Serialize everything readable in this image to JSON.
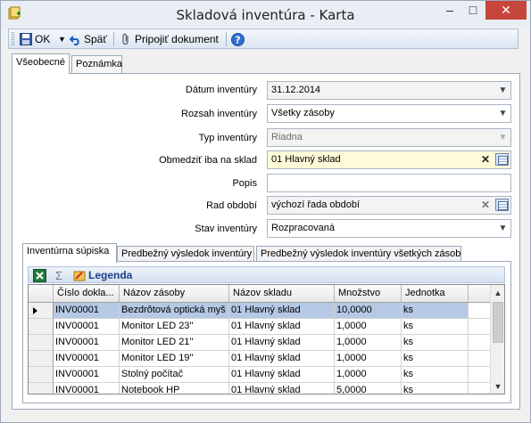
{
  "window": {
    "title": "Skladová inventúra - Karta",
    "close_glyph": "✕",
    "minimize_glyph": "–",
    "maximize_glyph": "□"
  },
  "toolbar": {
    "ok_label": "OK",
    "back_label": "Späť",
    "attach_label": "Pripojiť dokument"
  },
  "tabs": {
    "general": "Všeobecné",
    "note": "Poznámka"
  },
  "form": {
    "date": {
      "label": "Dátum inventúry",
      "value": "31.12.2014"
    },
    "scope": {
      "label": "Rozsah inventúry",
      "value": "Všetky zásoby"
    },
    "type": {
      "label": "Typ inventúry",
      "value": "Riadna"
    },
    "warehouse": {
      "label": "Obmedziť iba na sklad",
      "value": "01 Hlavný sklad"
    },
    "description": {
      "label": "Popis",
      "value": ""
    },
    "series": {
      "label": "Rad období",
      "value": "výchozí řada období"
    },
    "status": {
      "label": "Stav inventúry",
      "value": "Rozpracovaná"
    }
  },
  "subtabs": {
    "sheet": "Inventúrna súpiska",
    "preliminary": "Predbežný výsledok inventúry",
    "preliminary_all": "Predbežný výsledok inventúry všetkých zásob"
  },
  "grid_toolbar": {
    "legend_label": "Legenda",
    "sigma_glyph": "Σ"
  },
  "grid": {
    "columns": [
      "Číslo dokla...",
      "Názov zásoby",
      "Názov skladu",
      "Množstvo",
      "Jednotka"
    ],
    "rows": [
      [
        "INV00001",
        "Bezdrôtová optická myš",
        "01 Hlavný sklad",
        "10,0000",
        "ks"
      ],
      [
        "INV00001",
        "Monitor LED 23''",
        "01 Hlavný sklad",
        "1,0000",
        "ks"
      ],
      [
        "INV00001",
        "Monitor LED 21''",
        "01 Hlavný sklad",
        "1,0000",
        "ks"
      ],
      [
        "INV00001",
        "Monitor LED 19''",
        "01 Hlavný sklad",
        "1,0000",
        "ks"
      ],
      [
        "INV00001",
        "Stolný počítač",
        "01 Hlavný sklad",
        "1,0000",
        "ks"
      ],
      [
        "INV00001",
        "Notebook HP",
        "01 Hlavný sklad",
        "5,0000",
        "ks"
      ]
    ],
    "selected_row": 0
  },
  "colors": {
    "selection": "#b5c9e5",
    "highlight_field": "#fffbd9",
    "close_button": "#c7463c"
  }
}
